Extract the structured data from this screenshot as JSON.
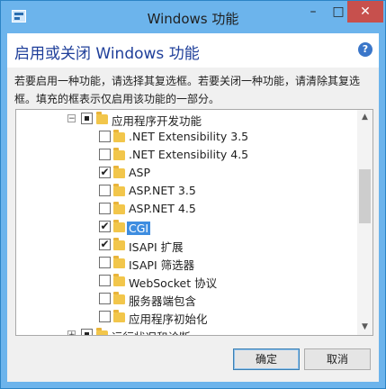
{
  "window": {
    "title": "Windows 功能",
    "controls": {
      "minimize": "–",
      "maximize": "□",
      "close": "✕"
    }
  },
  "header": {
    "title": "启用或关闭 Windows 功能",
    "help_icon": "?"
  },
  "description": "若要启用一种功能，请选择其复选框。若要关闭一种功能，请清除其复选框。填充的框表示仅启用该功能的一部分。",
  "tree": {
    "parent": {
      "label": "应用程序开发功能",
      "expander": "−",
      "state": "partial"
    },
    "children": [
      {
        "label": ".NET Extensibility 3.5",
        "checked": ""
      },
      {
        "label": ".NET Extensibility 4.5",
        "checked": ""
      },
      {
        "label": "ASP",
        "checked": "✔"
      },
      {
        "label": "ASP.NET 3.5",
        "checked": ""
      },
      {
        "label": "ASP.NET 4.5",
        "checked": ""
      },
      {
        "label": "CGI",
        "checked": "✔"
      },
      {
        "label": "ISAPI 扩展",
        "checked": "✔"
      },
      {
        "label": "ISAPI 筛选器",
        "checked": ""
      },
      {
        "label": "WebSocket 协议",
        "checked": ""
      },
      {
        "label": "服务器端包含",
        "checked": ""
      },
      {
        "label": "应用程序初始化",
        "checked": ""
      }
    ],
    "next_group": {
      "label": "运行状况和诊断",
      "expander": "+",
      "state": "partial"
    }
  },
  "scrollbar": {
    "up": "▲",
    "down": "▼"
  },
  "buttons": {
    "ok": "确定",
    "cancel": "取消"
  },
  "colors": {
    "title_bar": "#6cb4ec",
    "close_button": "#c7504d",
    "header_text": "#1f3f9a",
    "selection": "#3e8de0"
  }
}
